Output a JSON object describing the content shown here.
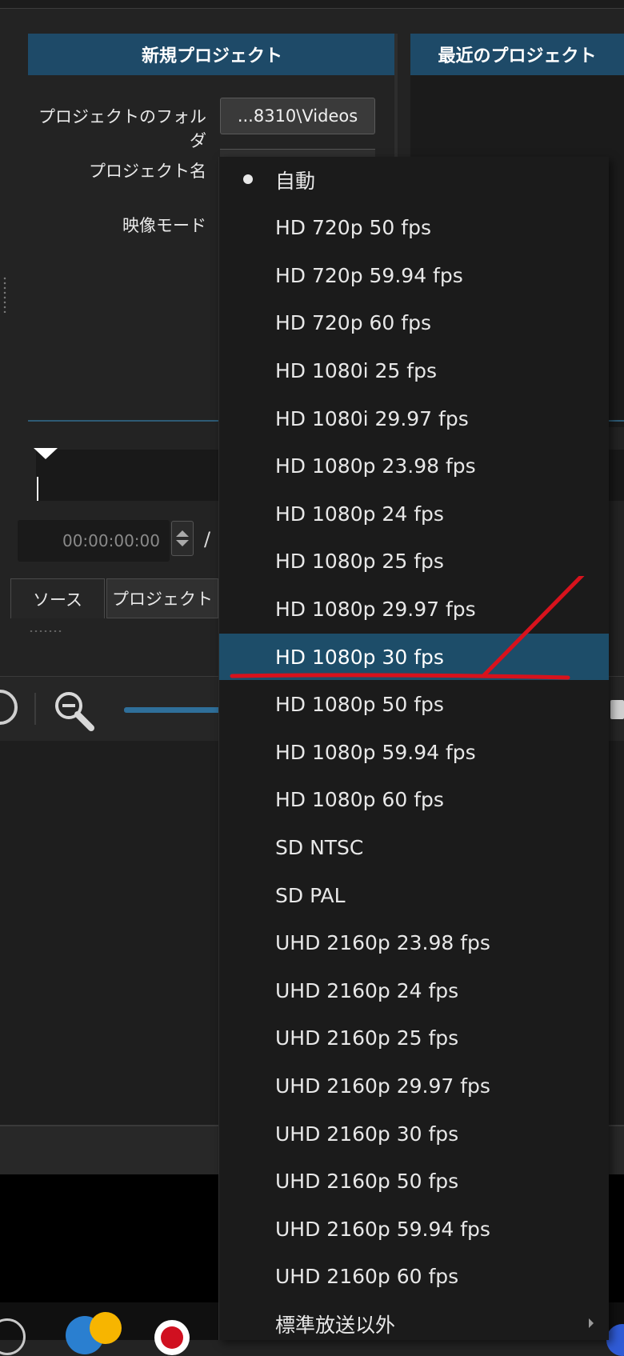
{
  "panels": {
    "new_project_title": "新規プロジェクト",
    "recent_projects_title": "最近のプロジェクト"
  },
  "form": {
    "folder_label": "プロジェクトのフォルダ",
    "folder_value": "...8310\\Videos",
    "name_label": "プロジェクト名",
    "mode_label": "映像モード"
  },
  "player": {
    "timecode": "00:00:00:00",
    "separator": "/"
  },
  "tabs": [
    {
      "label": "ソース"
    },
    {
      "label": "プロジェクト"
    }
  ],
  "video_mode_menu": {
    "selected_index": 10,
    "checked_index": 0,
    "items": [
      "自動",
      "HD 720p 50 fps",
      "HD 720p 59.94 fps",
      "HD 720p 60 fps",
      "HD 1080i 25 fps",
      "HD 1080i 29.97 fps",
      "HD 1080p 23.98 fps",
      "HD 1080p 24 fps",
      "HD 1080p 25 fps",
      "HD 1080p 29.97 fps",
      "HD 1080p 30 fps",
      "HD 1080p 50 fps",
      "HD 1080p 59.94 fps",
      "HD 1080p 60 fps",
      "SD NTSC",
      "SD PAL",
      "UHD 2160p 23.98 fps",
      "UHD 2160p 24 fps",
      "UHD 2160p 25 fps",
      "UHD 2160p 29.97 fps",
      "UHD 2160p 30 fps",
      "UHD 2160p 50 fps",
      "UHD 2160p 59.94 fps",
      "UHD 2160p 60 fps",
      "標準放送以外"
    ]
  },
  "icons": {
    "checked": "bullet-icon",
    "submenu": "chevron-right-icon",
    "zoom": "zoom-out-icon"
  },
  "colors": {
    "header_blue": "#1e4a68",
    "selection_blue": "#1d4d69",
    "annotation_red": "#d8121c"
  }
}
